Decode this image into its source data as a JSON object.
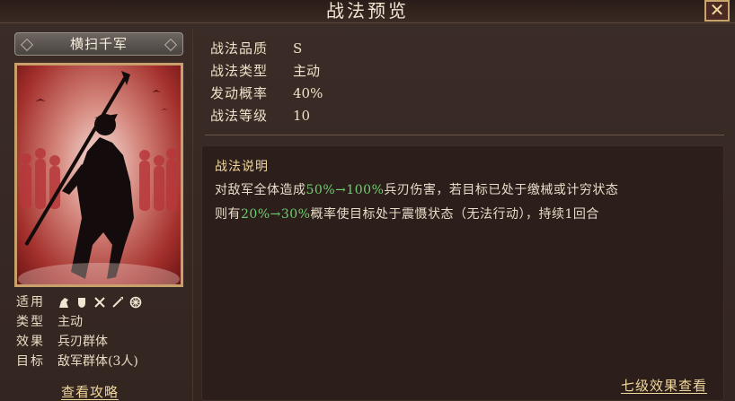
{
  "window": {
    "title": "战法预览",
    "close_label": "✕"
  },
  "skill": {
    "name": "横扫千军"
  },
  "info": {
    "units_label": "适用",
    "units_icons": [
      "horse-icon",
      "shield-icon",
      "crossed-swords-icon",
      "spear-icon",
      "wheel-icon"
    ],
    "type_label": "类型",
    "type_value": "主动",
    "effect_label": "效果",
    "effect_value": "兵刃群体",
    "target_label": "目标",
    "target_value": "敌军群体(3人)"
  },
  "guide_link": "查看攻略",
  "stats": [
    {
      "label": "战法品质",
      "value": "S"
    },
    {
      "label": "战法类型",
      "value": "主动"
    },
    {
      "label": "发动概率",
      "value": "40%"
    },
    {
      "label": "战法等级",
      "value": "10"
    }
  ],
  "description": {
    "title": "战法说明",
    "line1_a": "对敌军全体造成",
    "line1_g": "50%→100%",
    "line1_b": "兵刃伤害，若目标已处于缴械或计穷状态",
    "line2_a": "则有",
    "line2_g": "20%→30%",
    "line2_b": "概率使目标处于震慑状态（无法行动），持续1回合"
  },
  "level_link": "七级效果查看",
  "colors": {
    "accent_gold": "#f0d79c",
    "highlight_green": "#6fce6f",
    "card_red": "#a4302c"
  }
}
